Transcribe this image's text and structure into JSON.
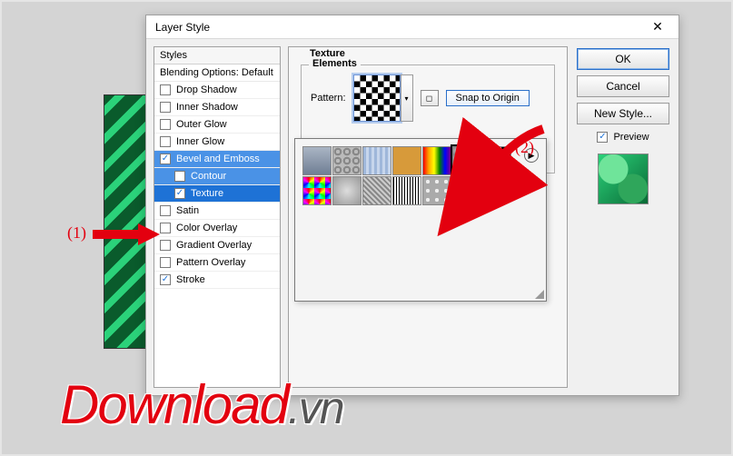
{
  "dialog": {
    "title": "Layer Style",
    "close_icon": "✕"
  },
  "styles": {
    "header": "Styles",
    "blending": "Blending Options: Default",
    "items": [
      {
        "label": "Drop Shadow",
        "checked": false
      },
      {
        "label": "Inner Shadow",
        "checked": false
      },
      {
        "label": "Outer Glow",
        "checked": false
      },
      {
        "label": "Inner Glow",
        "checked": false
      },
      {
        "label": "Bevel and Emboss",
        "checked": true,
        "highlight": true
      },
      {
        "label": "Contour",
        "checked": false,
        "indent": true,
        "highlight": true
      },
      {
        "label": "Texture",
        "checked": true,
        "indent": true,
        "selected": true
      },
      {
        "label": "Satin",
        "checked": false
      },
      {
        "label": "Color Overlay",
        "checked": false
      },
      {
        "label": "Gradient Overlay",
        "checked": false
      },
      {
        "label": "Pattern Overlay",
        "checked": false
      },
      {
        "label": "Stroke",
        "checked": true
      }
    ]
  },
  "settings": {
    "section": "Texture",
    "group": "Elements",
    "pattern_label": "Pattern:",
    "snap_label": "Snap to Origin"
  },
  "right": {
    "ok": "OK",
    "cancel": "Cancel",
    "new_style": "New Style...",
    "preview": "Preview"
  },
  "annotations": {
    "a1": "(1)",
    "a2": "(2)"
  },
  "watermark": {
    "main": "Download",
    "suffix": ".vn"
  }
}
